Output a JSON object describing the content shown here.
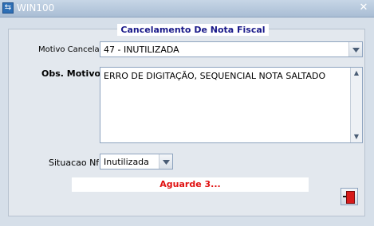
{
  "window": {
    "title": "WIN100"
  },
  "form": {
    "title": "Cancelamento De Nota Fiscal",
    "motivo_label": "Motivo Cancelame",
    "motivo_value": "47 - INUTILIZADA",
    "obs_label": "Obs. Motivo",
    "obs_value": "ERRO DE DIGITAÇÃO, SEQUENCIAL NOTA SALTADO",
    "situacao_label": "Situacao Nf",
    "situacao_value": "Inutilizada",
    "status_message": "Aguarde 3..."
  },
  "icons": {
    "app": "app-icon",
    "close": "close-icon",
    "exit": "exit-door-icon",
    "dropdown": "chevron-down-icon"
  },
  "colors": {
    "status_text": "#e01010",
    "title_text": "#1a1a8a",
    "window_bg": "#d6dfe9"
  }
}
